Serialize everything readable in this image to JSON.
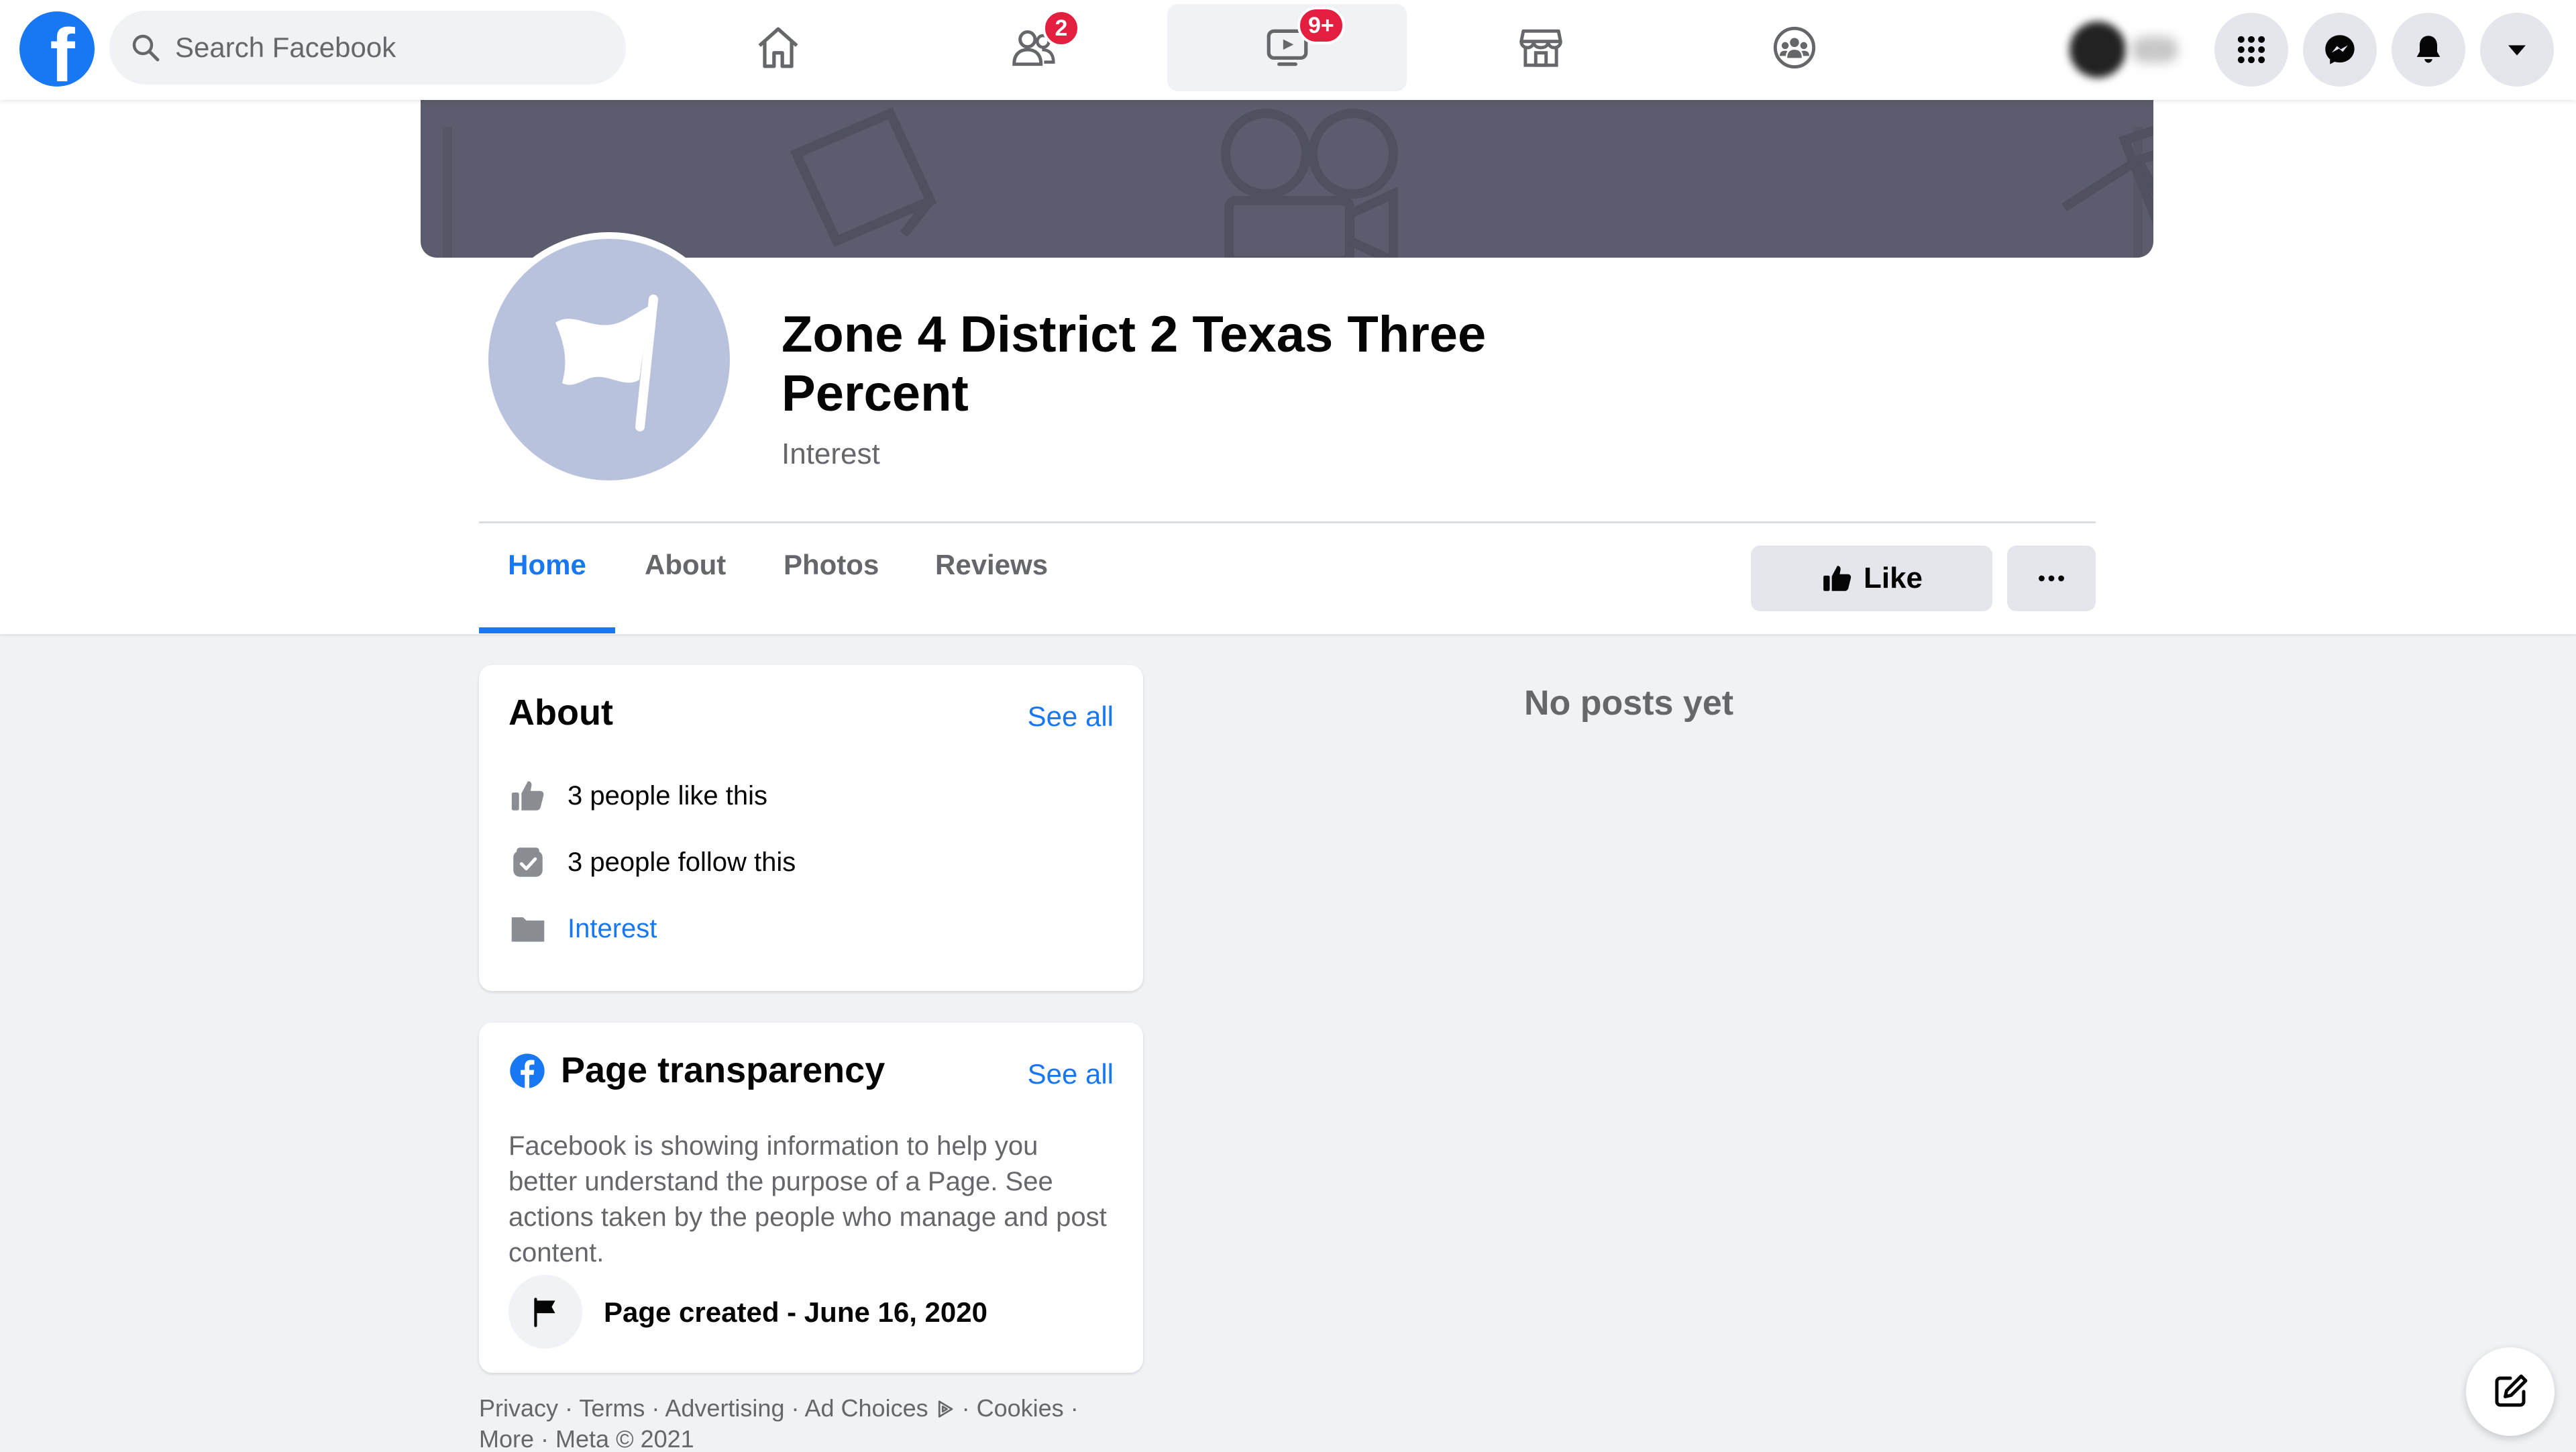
{
  "nav": {
    "logo_letter": "f",
    "search_placeholder": "Search Facebook",
    "friends_badge": "2",
    "watch_badge": "9+"
  },
  "page": {
    "name": "Zone 4 District 2 Texas Three Percent",
    "category": "Interest"
  },
  "tabs": [
    {
      "label": "Home",
      "active": true
    },
    {
      "label": "About",
      "active": false
    },
    {
      "label": "Photos",
      "active": false
    },
    {
      "label": "Reviews",
      "active": false
    }
  ],
  "actions": {
    "like_label": "Like"
  },
  "about_card": {
    "title": "About",
    "see_all": "See all",
    "likes": "3 people like this",
    "follows": "3 people follow this",
    "category_link": "Interest"
  },
  "transparency_card": {
    "title": "Page transparency",
    "see_all": "See all",
    "description": "Facebook is showing information to help you better understand the purpose of a Page. See actions taken by the people who manage and post content.",
    "created": "Page created - June 16, 2020"
  },
  "posts": {
    "empty_message": "No posts yet"
  },
  "footer": {
    "links": [
      "Privacy",
      "Terms",
      "Advertising",
      "Ad Choices",
      "Cookies",
      "More"
    ],
    "copyright": "Meta © 2021"
  },
  "colors": {
    "brand_blue": "#1877f2",
    "badge_red": "#e41e3f",
    "page_bg": "#f0f2f5",
    "cover_gray": "#5b5d6e"
  },
  "icons": {
    "nav": [
      "home-icon",
      "friends-icon",
      "watch-icon",
      "marketplace-icon",
      "groups-icon"
    ],
    "right": [
      "menu-grid-icon",
      "messenger-icon",
      "bell-icon",
      "caret-down-icon"
    ]
  }
}
